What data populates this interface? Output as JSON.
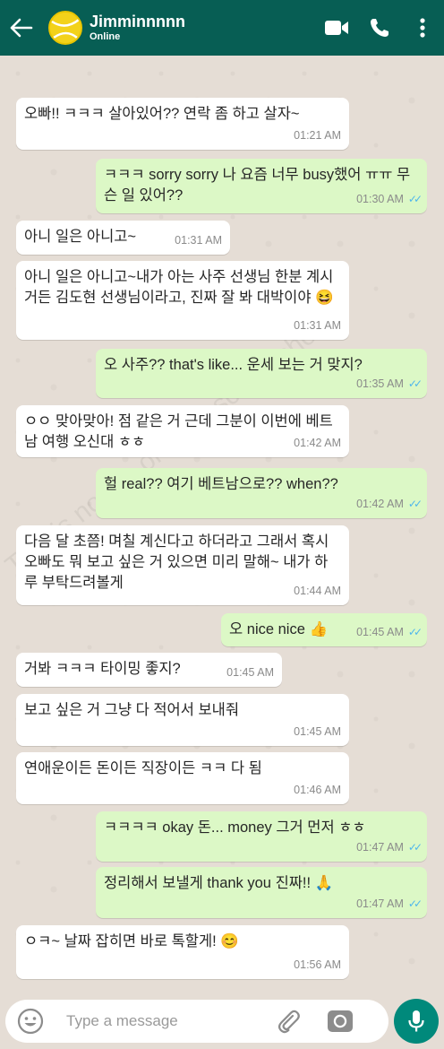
{
  "header": {
    "contact_name": "Jimminnnnn",
    "status": "Online",
    "bg_color": "#075e54"
  },
  "messages": [
    {
      "dir": "in",
      "text": "오빠!! ㅋㅋㅋ 살아있어?? 연락 좀 하고 살자~",
      "time": "01:21 AM"
    },
    {
      "dir": "out",
      "text": "ㅋㅋㅋ sorry sorry 나 요즘 너무 busy했어 ㅠㅠ 무슨 일 있어??",
      "time": "01:30 AM",
      "read": true
    },
    {
      "dir": "in",
      "text": "아니 일은 아니고~",
      "time": "01:31 AM"
    },
    {
      "dir": "in",
      "text": "아니 일은 아니고~내가 아는 사주 선생님 한분 계시거든 김도현 선생님이라고, 진짜 잘 봐 대박이야 😆",
      "time": "01:31 AM"
    },
    {
      "dir": "out",
      "text": "오 사주?? that's like... 운세 보는 거 맞지?",
      "time": "01:35 AM",
      "read": true
    },
    {
      "dir": "in",
      "text": "ㅇㅇ 맞아맞아! 점 같은 거 근데 그분이 이번에 베트남 여행 오신대 ㅎㅎ",
      "time": "01:42 AM"
    },
    {
      "dir": "out",
      "text": "헐 real?? 여기 베트남으로?? when??",
      "time": "01:42 AM",
      "read": true
    },
    {
      "dir": "in",
      "text": "다음 달 초쯤! 며칠 계신다고 하더라고 그래서 혹시 오빠도 뭐 보고 싶은 거 있으면 미리 말해~ 내가 하루 부탁드려볼게",
      "time": "01:44 AM"
    },
    {
      "dir": "out",
      "text": "오 nice nice 👍",
      "time": "01:45 AM",
      "read": true
    },
    {
      "dir": "in",
      "text": "거봐 ㅋㅋㅋ 타이밍 좋지?",
      "time": "01:45 AM"
    },
    {
      "dir": "in",
      "text": "보고 싶은 거 그냥 다 적어서 보내줘",
      "time": "01:45 AM"
    },
    {
      "dir": "in",
      "text": "연애운이든 돈이든 직장이든 ㅋㅋ 다 됨",
      "time": "01:46 AM"
    },
    {
      "dir": "out",
      "text": "ㅋㅋㅋㅋ okay 돈... money 그거 먼저 ㅎㅎ",
      "time": "01:47 AM",
      "read": true
    },
    {
      "dir": "out",
      "text": "정리해서 보낼게 thank you 진짜!! 🙏",
      "time": "01:47 AM",
      "read": true
    },
    {
      "dir": "in",
      "text": "ㅇㅋ~ 날짜 잡히면 바로 톡할게! 😊",
      "time": "01:56 AM"
    }
  ],
  "watermark": "This is not an original screenshot!!!",
  "composer": {
    "placeholder": "Type a message"
  },
  "icons": {
    "back": "back-arrow-icon",
    "video": "video-call-icon",
    "call": "phone-icon",
    "menu": "more-vert-icon",
    "emoji": "emoji-icon",
    "attach": "paperclip-icon",
    "camera": "camera-icon",
    "mic": "mic-icon"
  },
  "colors": {
    "incoming": "#ffffff",
    "outgoing": "#dcf8c6",
    "read_ticks": "#4fb6ec",
    "mic_button": "#00897b"
  }
}
